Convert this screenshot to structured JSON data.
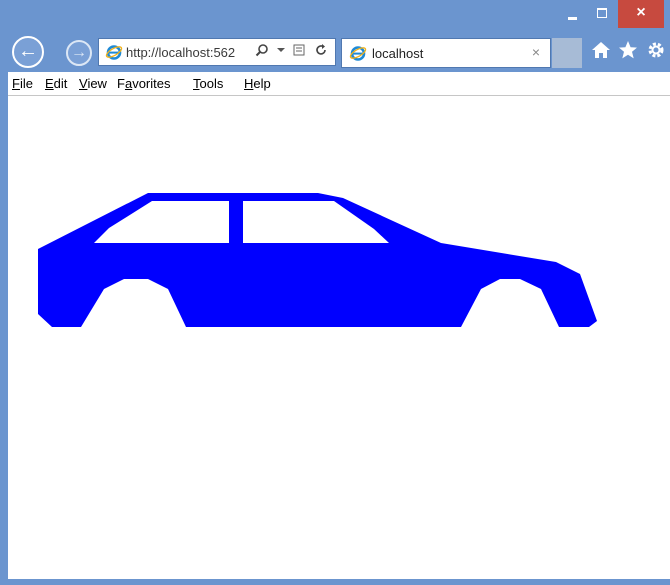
{
  "window": {
    "minimize_label": "",
    "maximize_label": "",
    "close_label": "×"
  },
  "navigation": {
    "back_label": "←",
    "forward_label": "→"
  },
  "address_bar": {
    "url": "http://localhost:562",
    "icons": [
      "search-icon",
      "dropdown-arrow-icon",
      "compatibility-icon",
      "refresh-icon"
    ]
  },
  "tab": {
    "title": "localhost",
    "close_label": "×"
  },
  "toolbar_icons": [
    "home-icon",
    "favorites-star-icon",
    "settings-gear-icon"
  ],
  "menu": {
    "items": [
      {
        "label": "File",
        "underline": "F"
      },
      {
        "label": "Edit",
        "underline": "E"
      },
      {
        "label": "View",
        "underline": "V"
      },
      {
        "label": "Favorites",
        "underline": "a"
      },
      {
        "label": "Tools",
        "underline": "T"
      },
      {
        "label": "Help",
        "underline": "H"
      }
    ]
  },
  "content": {
    "background": "#ffffff",
    "car_color": "#0000ff",
    "window_color": "#ffffff"
  },
  "colors": {
    "frame": "#6b95cf",
    "close_button": "#c74a3f"
  }
}
